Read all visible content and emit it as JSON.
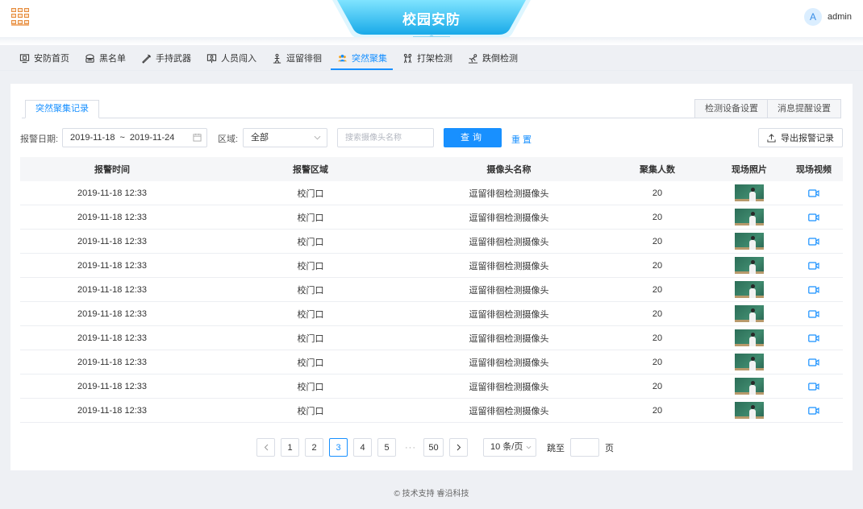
{
  "header": {
    "title": "校园安防",
    "user": {
      "avatar_letter": "A",
      "name": "admin"
    }
  },
  "nav": [
    {
      "label": "安防首页",
      "icon": "monitor-icon"
    },
    {
      "label": "黑名单",
      "icon": "blacklist-icon"
    },
    {
      "label": "手持武器",
      "icon": "weapon-icon"
    },
    {
      "label": "人员闯入",
      "icon": "intrusion-icon"
    },
    {
      "label": "逗留徘徊",
      "icon": "loiter-icon"
    },
    {
      "label": "突然聚集",
      "icon": "crowd-icon",
      "active": true
    },
    {
      "label": "打架检测",
      "icon": "fight-icon"
    },
    {
      "label": "跌倒检测",
      "icon": "fall-icon"
    }
  ],
  "panel": {
    "tab": "突然聚集记录",
    "settings_buttons": [
      "检测设备设置",
      "消息提醒设置"
    ],
    "filters": {
      "date_label": "报警日期:",
      "date_start": "2019-11-18",
      "date_sep": "~",
      "date_end": "2019-11-24",
      "area_label": "区域:",
      "area_value": "全部",
      "search_placeholder": "搜索摄像头名称",
      "query_label": "查询",
      "reset_label": "重置",
      "export_label": "导出报警记录"
    },
    "table": {
      "columns": [
        "报警时间",
        "报警区域",
        "摄像头名称",
        "聚集人数",
        "现场照片",
        "现场视频"
      ],
      "rows": [
        {
          "time": "2019-11-18 12:33",
          "area": "校门口",
          "camera": "逗留徘徊检测摄像头",
          "count": "20"
        },
        {
          "time": "2019-11-18 12:33",
          "area": "校门口",
          "camera": "逗留徘徊检测摄像头",
          "count": "20"
        },
        {
          "time": "2019-11-18 12:33",
          "area": "校门口",
          "camera": "逗留徘徊检测摄像头",
          "count": "20"
        },
        {
          "time": "2019-11-18 12:33",
          "area": "校门口",
          "camera": "逗留徘徊检测摄像头",
          "count": "20"
        },
        {
          "time": "2019-11-18 12:33",
          "area": "校门口",
          "camera": "逗留徘徊检测摄像头",
          "count": "20"
        },
        {
          "time": "2019-11-18 12:33",
          "area": "校门口",
          "camera": "逗留徘徊检测摄像头",
          "count": "20"
        },
        {
          "time": "2019-11-18 12:33",
          "area": "校门口",
          "camera": "逗留徘徊检测摄像头",
          "count": "20"
        },
        {
          "time": "2019-11-18 12:33",
          "area": "校门口",
          "camera": "逗留徘徊检测摄像头",
          "count": "20"
        },
        {
          "time": "2019-11-18 12:33",
          "area": "校门口",
          "camera": "逗留徘徊检测摄像头",
          "count": "20"
        },
        {
          "time": "2019-11-18 12:33",
          "area": "校门口",
          "camera": "逗留徘徊检测摄像头",
          "count": "20"
        }
      ]
    },
    "pagination": {
      "pages": [
        "1",
        "2",
        "3",
        "4",
        "5"
      ],
      "current": "3",
      "ellipsis": "···",
      "last": "50",
      "page_size": "10 条/页",
      "jump_label": "跳至",
      "page_label": "页"
    }
  },
  "footer": "© 技术支持 睿沿科技",
  "colors": {
    "accent": "#1890ff",
    "background": "#eef0f4",
    "title_plate": "#3ec6f0"
  }
}
